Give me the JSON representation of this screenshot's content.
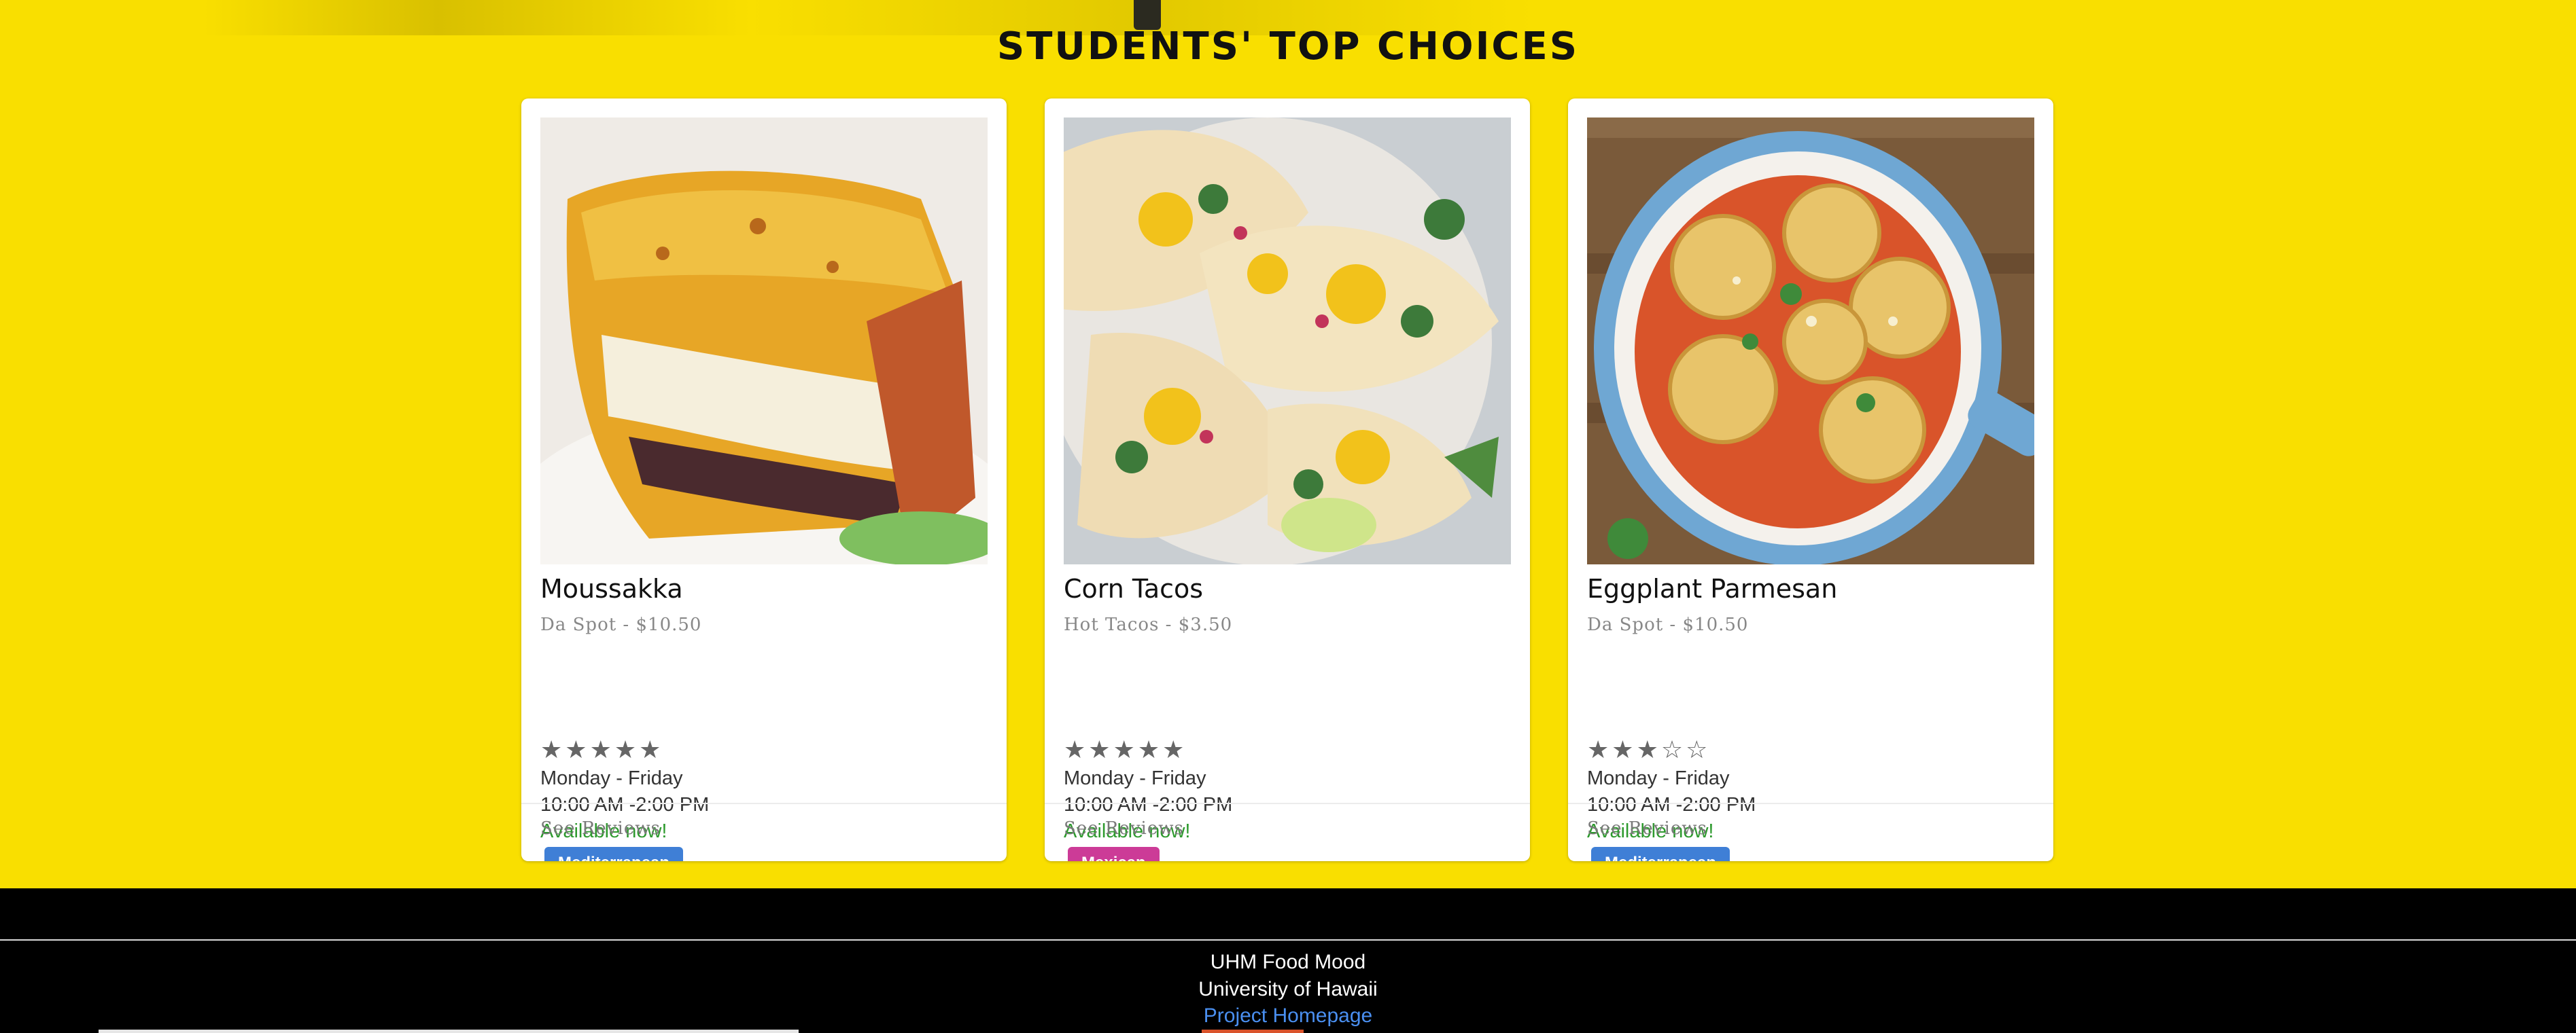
{
  "section": {
    "title": "STUDENTS' TOP CHOICES"
  },
  "cards": [
    {
      "name": "Moussakka",
      "vendor_price": "Da Spot - $10.50",
      "rating": 5,
      "days": "Monday - Friday",
      "hours": "10:00 AM -2:00 PM",
      "status": "Available now!",
      "tag": "Mediterranean",
      "tag_color": "#3f7fd6",
      "reviews_link": "See Reviews"
    },
    {
      "name": "Corn Tacos",
      "vendor_price": "Hot Tacos - $3.50",
      "rating": 5,
      "days": "Monday - Friday",
      "hours": "10:00 AM -2:00 PM",
      "status": "Available now!",
      "tag": "Mexican",
      "tag_color": "#cc3b97",
      "reviews_link": "See Reviews"
    },
    {
      "name": "Eggplant Parmesan",
      "vendor_price": "Da Spot - $10.50",
      "rating": 3,
      "days": "Monday - Friday",
      "hours": "10:00 AM -2:00 PM",
      "status": "Available now!",
      "tag": "Mediterranean",
      "tag_color": "#3f7fd6",
      "reviews_link": "See Reviews"
    }
  ],
  "footer": {
    "line1": "UHM Food Mood",
    "line2": "University of Hawaii",
    "link": "Project Homepage"
  },
  "colors": {
    "page_yellow": "#f9df00",
    "footer_bg": "#000000",
    "available_green": "#2e9a2e",
    "link_blue": "#4a8ff0"
  }
}
